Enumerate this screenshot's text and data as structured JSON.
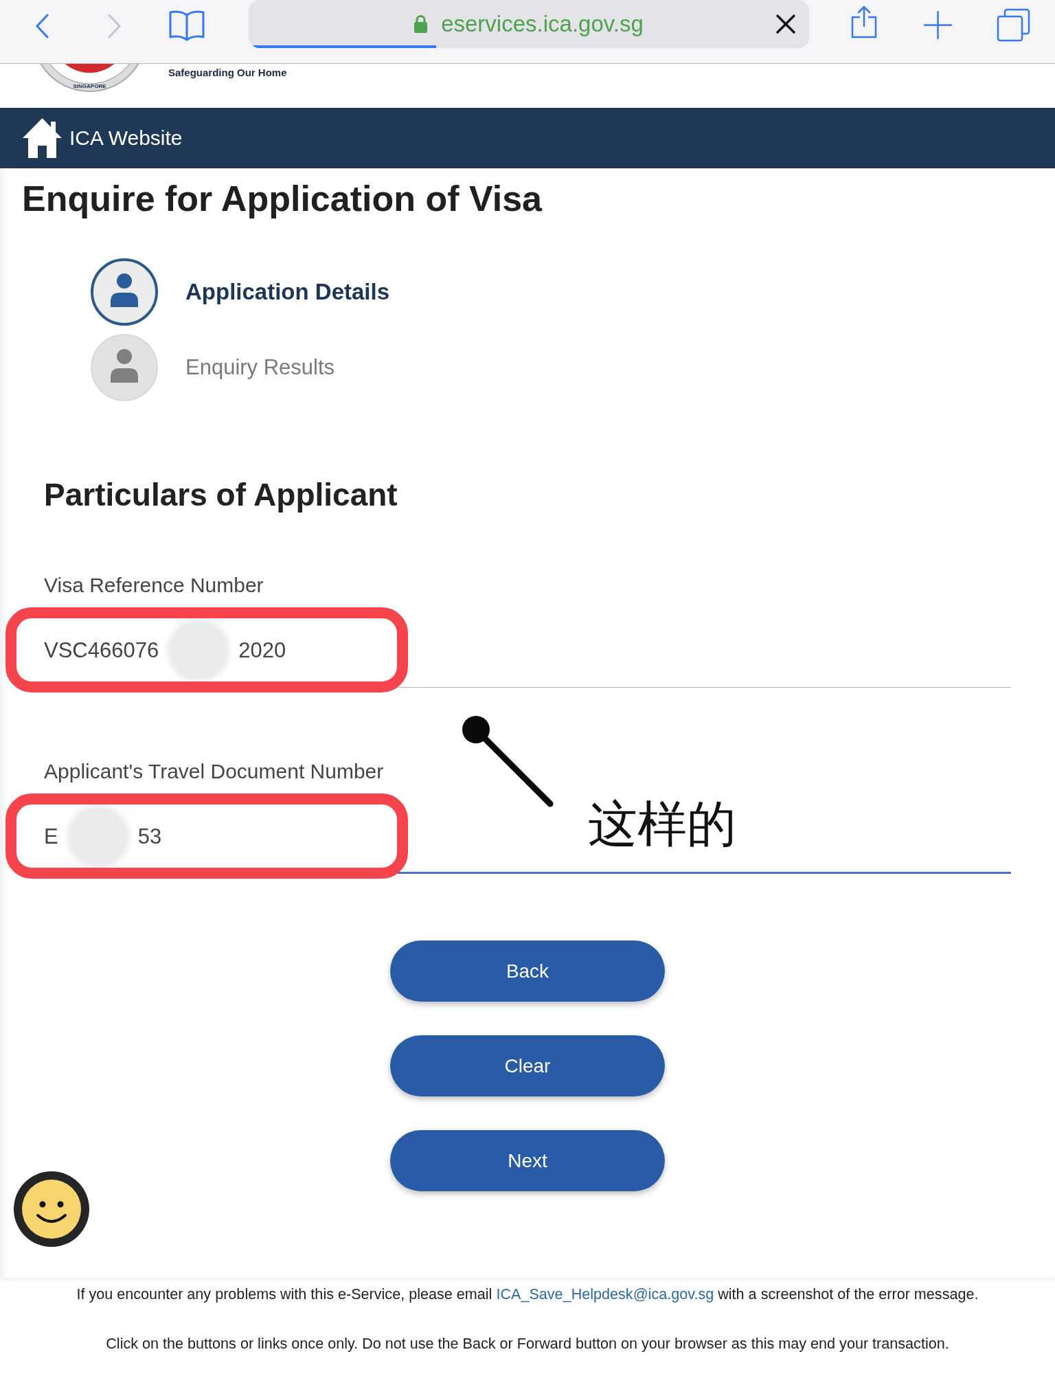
{
  "browser": {
    "url": "eservices.ica.gov.sg",
    "progress": {
      "level": 0.335
    },
    "forward_disabled": true
  },
  "header": {
    "logo_text": "SINGAPORE",
    "tagline": "Safeguarding Our Home"
  },
  "nav_bar": {
    "link": "ICA Website"
  },
  "page_title": "Enquire for Application of Visa",
  "steps": [
    {
      "label": "Application Details",
      "selected": true
    },
    {
      "label": "Enquiry Results",
      "selected": false
    }
  ],
  "section_title": "Particulars of Applicant",
  "fields": [
    {
      "label": "Visa Reference Number",
      "value_start": "VSC466076",
      "value_end": "2020",
      "focused": false,
      "highlighted": true
    },
    {
      "label": "Applicant's Travel Document Number",
      "value_start": "E",
      "value_end": "53",
      "focused": true,
      "highlighted": true
    }
  ],
  "annotation": {
    "text": "这样的"
  },
  "buttons": [
    "Back",
    "Clear",
    "Next"
  ],
  "footer": {
    "help": "If you encounter any problems with this e-Service, please email ",
    "email": "ICA_Save_Helpdesk@ica.gov.sg",
    "help_after": " with a screenshot of the error message.",
    "notice": "Click on the buttons or links once only. Do not use the Back or Forward button on your browser as this may end your transaction."
  }
}
